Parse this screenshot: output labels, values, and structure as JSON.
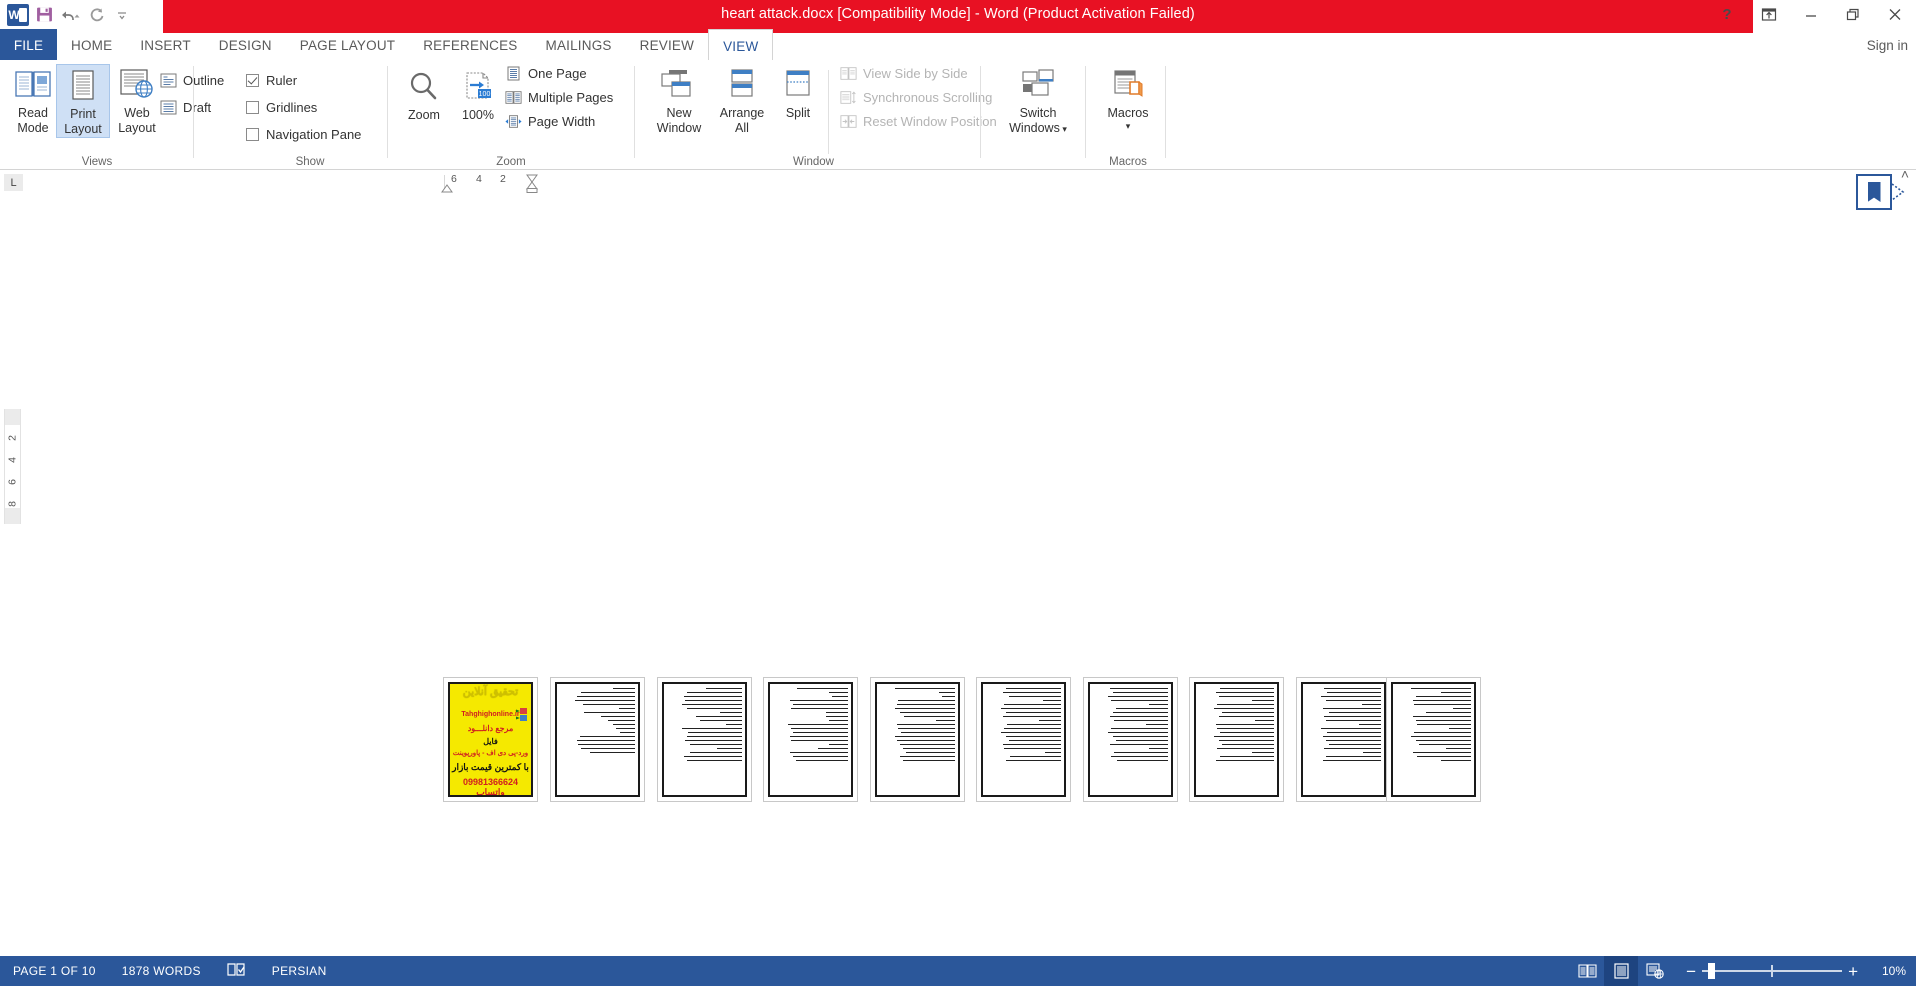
{
  "titlebar": {
    "document_title": "heart attack.docx [Compatibility Mode]  -  Word (Product Activation Failed)",
    "quick_access": [
      {
        "name": "word-logo",
        "label": "W"
      },
      {
        "name": "save-icon",
        "label": "Save"
      },
      {
        "name": "undo-icon",
        "label": "Undo"
      },
      {
        "name": "redo-icon",
        "label": "Redo"
      },
      {
        "name": "customize-qat-icon",
        "label": "Customize Quick Access Toolbar"
      }
    ],
    "window_controls": [
      {
        "name": "help-button",
        "glyph": "?"
      },
      {
        "name": "ribbon-display-options-button",
        "glyph": ""
      },
      {
        "name": "minimize-button",
        "glyph": "—"
      },
      {
        "name": "restore-button",
        "glyph": ""
      },
      {
        "name": "close-button",
        "glyph": "✕"
      }
    ]
  },
  "tabs": [
    {
      "label": "FILE",
      "active": false
    },
    {
      "label": "HOME",
      "active": false
    },
    {
      "label": "INSERT",
      "active": false
    },
    {
      "label": "DESIGN",
      "active": false
    },
    {
      "label": "PAGE LAYOUT",
      "active": false
    },
    {
      "label": "REFERENCES",
      "active": false
    },
    {
      "label": "MAILINGS",
      "active": false
    },
    {
      "label": "REVIEW",
      "active": false
    },
    {
      "label": "VIEW",
      "active": true
    }
  ],
  "signin": "Sign in",
  "ribbon": {
    "groups": [
      {
        "name": "views",
        "label": "Views",
        "buttons": [
          {
            "label_line1": "Read",
            "label_line2": "Mode",
            "selected": false
          },
          {
            "label_line1": "Print",
            "label_line2": "Layout",
            "selected": true
          },
          {
            "label_line1": "Web",
            "label_line2": "Layout",
            "selected": false
          }
        ],
        "small_items": [
          {
            "label": "Outline"
          },
          {
            "label": "Draft"
          }
        ]
      },
      {
        "name": "show",
        "label": "Show",
        "checkboxes": [
          {
            "label": "Ruler",
            "checked": true
          },
          {
            "label": "Gridlines",
            "checked": false
          },
          {
            "label": "Navigation Pane",
            "checked": false
          }
        ]
      },
      {
        "name": "zoom",
        "label": "Zoom",
        "buttons": [
          {
            "label_line1": "Zoom",
            "label_line2": ""
          },
          {
            "label_line1": "100%",
            "label_line2": ""
          }
        ],
        "small_items": [
          {
            "label": "One Page"
          },
          {
            "label": "Multiple Pages"
          },
          {
            "label": "Page Width"
          }
        ]
      },
      {
        "name": "window",
        "label": "Window",
        "buttons": [
          {
            "label_line1": "New",
            "label_line2": "Window"
          },
          {
            "label_line1": "Arrange",
            "label_line2": "All"
          },
          {
            "label_line1": "Split",
            "label_line2": ""
          }
        ],
        "small_items": [
          {
            "label": "View Side by Side",
            "disabled": true
          },
          {
            "label": "Synchronous Scrolling",
            "disabled": true
          },
          {
            "label": "Reset Window Position",
            "disabled": true
          }
        ]
      },
      {
        "name": "window-switch",
        "label": "",
        "buttons": [
          {
            "label_line1": "Switch",
            "label_line2": "Windows"
          }
        ]
      },
      {
        "name": "macros",
        "label": "Macros",
        "buttons": [
          {
            "label_line1": "Macros",
            "label_line2": ""
          }
        ]
      }
    ]
  },
  "rulers": {
    "tab_selector": "L",
    "horizontal_marks": [
      "6",
      "4",
      "2"
    ],
    "vertical_marks": [
      "2",
      "4",
      "6",
      "8"
    ]
  },
  "resume_reading": {
    "name": "resume-reading-bookmark",
    "collapse_glyph": "˄"
  },
  "document": {
    "page_count": 10,
    "ad_page": {
      "headline": "تحقیق آنلاین",
      "site": "Tahghighonline.ir",
      "line3": "مرجع دانلـــود",
      "line4": "فایل",
      "line5": "ورد-پی دی اف - پاورپوینت",
      "line6": "با کمترین قیمت بازار",
      "line7": "09981366624 واتساپ",
      "bg_color": "#f5e900"
    },
    "text_pages": [
      {
        "index": 2,
        "line_widths": [
          30,
          72,
          78,
          80,
          70,
          22,
          68,
          46,
          36,
          30,
          26,
          20,
          74,
          78,
          76,
          72,
          60
        ]
      },
      {
        "index": 3,
        "line_widths": [
          48,
          74,
          78,
          76,
          80,
          74,
          30,
          62,
          56,
          22,
          80,
          72,
          74,
          76,
          70,
          34,
          70,
          78,
          74
        ]
      },
      {
        "index": 4,
        "line_widths": [
          68,
          26,
          22,
          78,
          74,
          76,
          30,
          30,
          26,
          80,
          76,
          74,
          78,
          76,
          26,
          40,
          78,
          74,
          70
        ]
      },
      {
        "index": 5,
        "line_widths": [
          80,
          22,
          18,
          76,
          78,
          80,
          74,
          68,
          26,
          78,
          76,
          72,
          80,
          78,
          74,
          70,
          66,
          74,
          70
        ]
      },
      {
        "index": 6,
        "line_widths": [
          74,
          78,
          70,
          24,
          76,
          80,
          74,
          78,
          30,
          72,
          76,
          80,
          74,
          70,
          78,
          76,
          22,
          68,
          74
        ]
      },
      {
        "index": 7,
        "line_widths": [
          78,
          74,
          80,
          76,
          26,
          70,
          74,
          78,
          72,
          30,
          76,
          80,
          74,
          70,
          78,
          26,
          72,
          76,
          68
        ]
      },
      {
        "index": 8,
        "line_widths": [
          72,
          78,
          74,
          30,
          76,
          80,
          70,
          74,
          26,
          78,
          76,
          72,
          80,
          74,
          70,
          76,
          30,
          72,
          78
        ]
      },
      {
        "index": 9,
        "line_widths": [
          76,
          72,
          80,
          74,
          26,
          78,
          70,
          76,
          74,
          30,
          80,
          72,
          78,
          74,
          70,
          76,
          24,
          74,
          78
        ]
      },
      {
        "index": 10,
        "line_widths": [
          80,
          40,
          74,
          78,
          76,
          24,
          60,
          78,
          74,
          72,
          30,
          76,
          80,
          74,
          70,
          34,
          78,
          72,
          40
        ]
      }
    ]
  },
  "statusbar": {
    "page_info": "PAGE 1 OF 10",
    "word_count": "1878 WORDS",
    "proofing_icon": "spell-check-icon",
    "language": "PERSIAN",
    "view_buttons": [
      {
        "name": "read-mode-view-button",
        "active": false
      },
      {
        "name": "print-layout-view-button",
        "active": true
      },
      {
        "name": "web-layout-view-button",
        "active": false
      }
    ],
    "zoom_out": "−",
    "zoom_in": "+",
    "zoom_level": "10%"
  }
}
